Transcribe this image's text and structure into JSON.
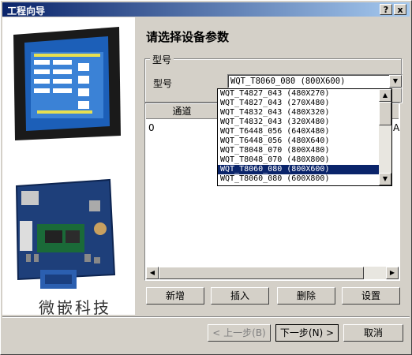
{
  "window": {
    "title": "工程向导",
    "help_btn": "?",
    "close_btn": "x"
  },
  "brand": {
    "text": "微嵌科技"
  },
  "page": {
    "heading": "请选择设备参数"
  },
  "model_group": {
    "legend": "型号",
    "label": "型号",
    "selected": "WQT_T8060_080 (800X600)",
    "options": [
      "WQT_T4827_043 (480X270)",
      "WQT_T4827_043 (270X480)",
      "WQT_T4832_043 (480X320)",
      "WQT_T4832_043 (320X480)",
      "WQT_T6448_056 (640X480)",
      "WQT_T6448_056 (480X640)",
      "WQT_T8048_070 (800X480)",
      "WQT_T8048_070 (480X800)",
      "WQT_T8060_080 (800X600)",
      "WQT_T8060_080 (600X800)"
    ],
    "selected_index": 8
  },
  "grid": {
    "columns": [
      "通道"
    ],
    "rows": [
      [
        "0"
      ]
    ],
    "trailing_char": "A"
  },
  "actions": {
    "add": "新增",
    "insert": "插入",
    "delete": "删除",
    "settings": "设置"
  },
  "footer": {
    "prev": "< 上一步(B)",
    "next": "下一步(N) >",
    "cancel": "取消"
  }
}
